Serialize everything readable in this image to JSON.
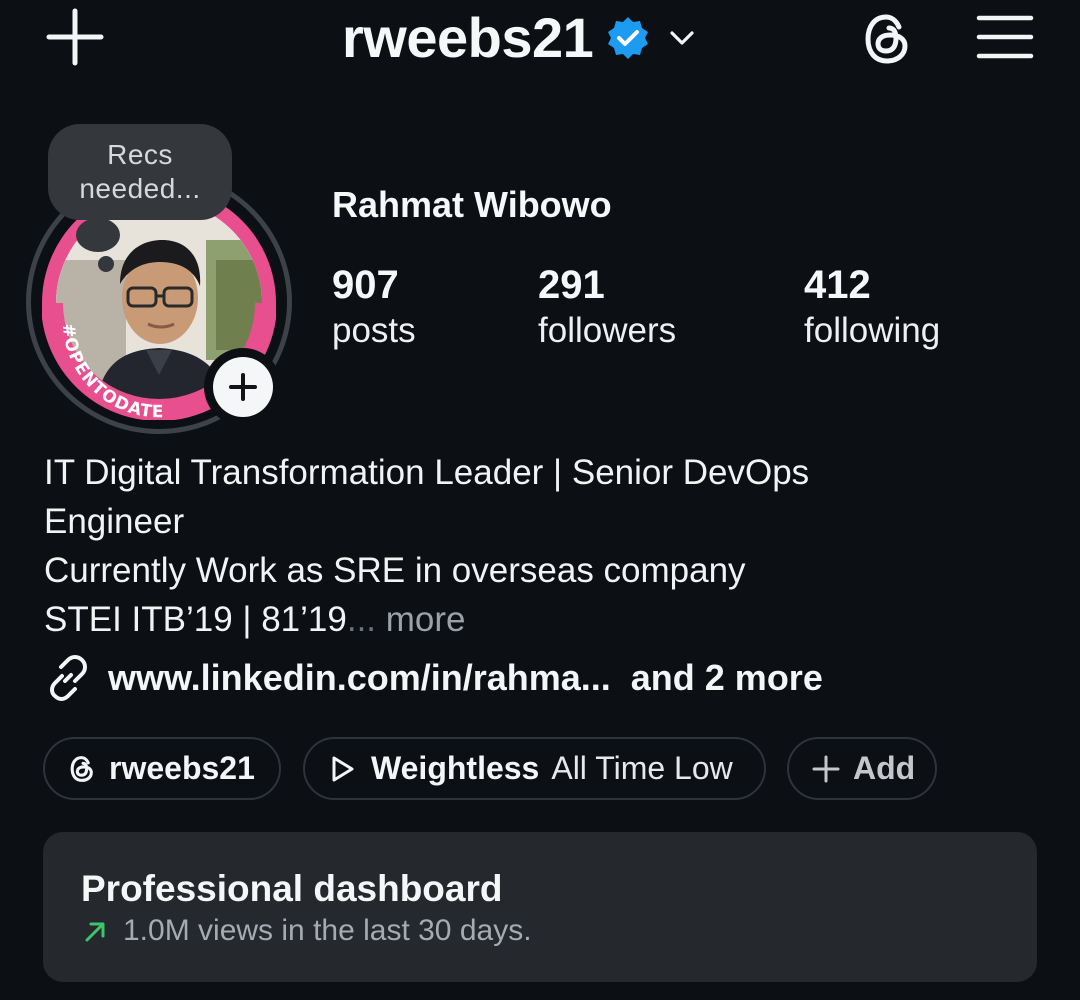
{
  "header": {
    "username": "rweebs21",
    "verified": true,
    "icons": {
      "create": "plus-icon",
      "verified": "verified-badge-icon",
      "switch_account": "chevron-down-icon",
      "threads": "threads-icon",
      "menu": "hamburger-menu-icon"
    }
  },
  "note": {
    "text_line1": "Recs",
    "text_line2": "needed..."
  },
  "avatar": {
    "ring_text": "#OPENTODATE",
    "ring_color": "#e84f8f",
    "add_story_icon": "plus-icon"
  },
  "profile": {
    "display_name": "Rahmat Wibowo",
    "stats": [
      {
        "value": "907",
        "label": "posts"
      },
      {
        "value": "291",
        "label": "followers"
      },
      {
        "value": "412",
        "label": "following"
      }
    ]
  },
  "bio": {
    "line1": "IT Digital Transformation Leader | Senior DevOps",
    "line2": "Engineer",
    "line3": "Currently Work as SRE in overseas company",
    "line4": "STEI ITB’19 | 81’19",
    "ellipsis": "...",
    "more": "more"
  },
  "links": {
    "icon": "link-icon",
    "url": "www.linkedin.com/in/rahma...",
    "more": "and 2 more"
  },
  "pills": {
    "threads": {
      "icon": "threads-icon",
      "label": "rweebs21"
    },
    "music": {
      "icon": "play-icon",
      "song": "Weightless",
      "artist": "All Time Low"
    },
    "add": {
      "icon": "plus-icon",
      "label": "Add"
    }
  },
  "dashboard": {
    "title": "Professional dashboard",
    "subtitle": "1.0M views in the last 30 days.",
    "trend_icon": "trend-up-arrow-icon",
    "trend_color": "#3ec46d"
  },
  "colors": {
    "background": "#0c1015",
    "card": "#25282d",
    "pill_border": "#2f333a",
    "verified_blue": "#1d9bf0"
  }
}
